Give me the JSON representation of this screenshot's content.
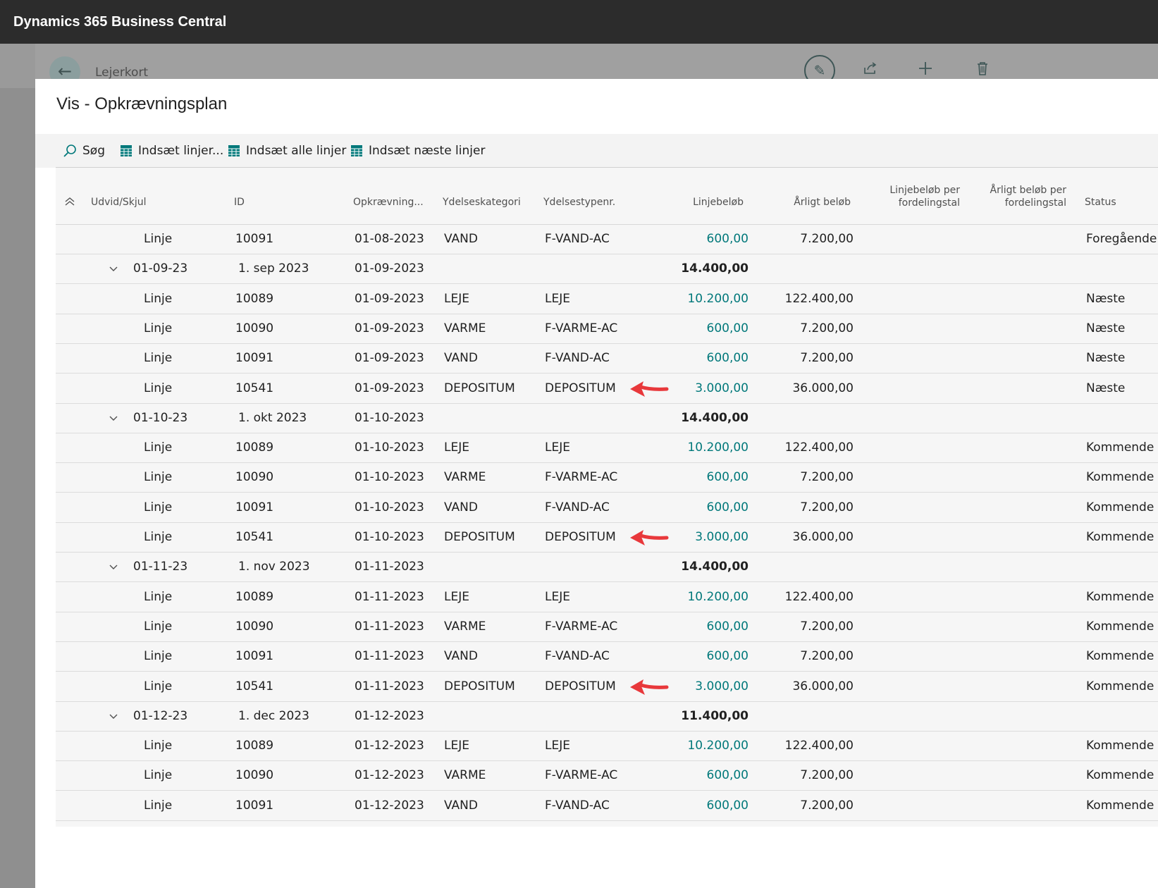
{
  "app": {
    "title": "Dynamics 365 Business Central"
  },
  "background_page": {
    "title": "Lejerkort"
  },
  "dialog": {
    "title": "Vis - Opkrævningsplan"
  },
  "actions": {
    "search": "Søg",
    "insert_lines": "Indsæt linjer...",
    "insert_all_lines": "Indsæt alle linjer",
    "insert_next_lines": "Indsæt næste linjer"
  },
  "columns": {
    "expand": "Udvid/Skjul",
    "id": "ID",
    "billing": "Opkrævning...",
    "category": "Ydelseskategori",
    "type": "Ydelsestypenr.",
    "line_amount": "Linjebeløb",
    "annual_amount": "Årligt beløb",
    "line_per_1": "Linjebeløb per",
    "line_per_2": "fordelingstal",
    "annual_per_1": "Årligt beløb per",
    "annual_per_2": "fordelingstal",
    "status": "Status"
  },
  "rows": [
    {
      "kind": "line",
      "label": "Linje",
      "id": "10091",
      "date": "01-08-2023",
      "category": "VAND",
      "type": "F-VAND-AC",
      "amount": "600,00",
      "annual": "7.200,00",
      "status": "Foregående"
    },
    {
      "kind": "group",
      "label": "01-09-23",
      "id": "1. sep 2023",
      "date": "01-09-2023",
      "amount": "14.400,00"
    },
    {
      "kind": "line",
      "label": "Linje",
      "id": "10089",
      "date": "01-09-2023",
      "category": "LEJE",
      "type": "LEJE",
      "amount": "10.200,00",
      "annual": "122.400,00",
      "status": "Næste"
    },
    {
      "kind": "line",
      "label": "Linje",
      "id": "10090",
      "date": "01-09-2023",
      "category": "VARME",
      "type": "F-VARME-AC",
      "amount": "600,00",
      "annual": "7.200,00",
      "status": "Næste"
    },
    {
      "kind": "line",
      "label": "Linje",
      "id": "10091",
      "date": "01-09-2023",
      "category": "VAND",
      "type": "F-VAND-AC",
      "amount": "600,00",
      "annual": "7.200,00",
      "status": "Næste"
    },
    {
      "kind": "line",
      "label": "Linje",
      "id": "10541",
      "date": "01-09-2023",
      "category": "DEPOSITUM",
      "type": "DEPOSITUM",
      "amount": "3.000,00",
      "annual": "36.000,00",
      "status": "Næste",
      "arrow": true
    },
    {
      "kind": "group",
      "label": "01-10-23",
      "id": "1. okt 2023",
      "date": "01-10-2023",
      "amount": "14.400,00"
    },
    {
      "kind": "line",
      "label": "Linje",
      "id": "10089",
      "date": "01-10-2023",
      "category": "LEJE",
      "type": "LEJE",
      "amount": "10.200,00",
      "annual": "122.400,00",
      "status": "Kommende"
    },
    {
      "kind": "line",
      "label": "Linje",
      "id": "10090",
      "date": "01-10-2023",
      "category": "VARME",
      "type": "F-VARME-AC",
      "amount": "600,00",
      "annual": "7.200,00",
      "status": "Kommende"
    },
    {
      "kind": "line",
      "label": "Linje",
      "id": "10091",
      "date": "01-10-2023",
      "category": "VAND",
      "type": "F-VAND-AC",
      "amount": "600,00",
      "annual": "7.200,00",
      "status": "Kommende"
    },
    {
      "kind": "line",
      "label": "Linje",
      "id": "10541",
      "date": "01-10-2023",
      "category": "DEPOSITUM",
      "type": "DEPOSITUM",
      "amount": "3.000,00",
      "annual": "36.000,00",
      "status": "Kommende",
      "arrow": true
    },
    {
      "kind": "group",
      "label": "01-11-23",
      "id": "1. nov 2023",
      "date": "01-11-2023",
      "amount": "14.400,00"
    },
    {
      "kind": "line",
      "label": "Linje",
      "id": "10089",
      "date": "01-11-2023",
      "category": "LEJE",
      "type": "LEJE",
      "amount": "10.200,00",
      "annual": "122.400,00",
      "status": "Kommende"
    },
    {
      "kind": "line",
      "label": "Linje",
      "id": "10090",
      "date": "01-11-2023",
      "category": "VARME",
      "type": "F-VARME-AC",
      "amount": "600,00",
      "annual": "7.200,00",
      "status": "Kommende"
    },
    {
      "kind": "line",
      "label": "Linje",
      "id": "10091",
      "date": "01-11-2023",
      "category": "VAND",
      "type": "F-VAND-AC",
      "amount": "600,00",
      "annual": "7.200,00",
      "status": "Kommende"
    },
    {
      "kind": "line",
      "label": "Linje",
      "id": "10541",
      "date": "01-11-2023",
      "category": "DEPOSITUM",
      "type": "DEPOSITUM",
      "amount": "3.000,00",
      "annual": "36.000,00",
      "status": "Kommende",
      "arrow": true
    },
    {
      "kind": "group",
      "label": "01-12-23",
      "id": "1. dec 2023",
      "date": "01-12-2023",
      "amount": "11.400,00"
    },
    {
      "kind": "line",
      "label": "Linje",
      "id": "10089",
      "date": "01-12-2023",
      "category": "LEJE",
      "type": "LEJE",
      "amount": "10.200,00",
      "annual": "122.400,00",
      "status": "Kommende"
    },
    {
      "kind": "line",
      "label": "Linje",
      "id": "10090",
      "date": "01-12-2023",
      "category": "VARME",
      "type": "F-VARME-AC",
      "amount": "600,00",
      "annual": "7.200,00",
      "status": "Kommende"
    },
    {
      "kind": "line",
      "label": "Linje",
      "id": "10091",
      "date": "01-12-2023",
      "category": "VAND",
      "type": "F-VAND-AC",
      "amount": "600,00",
      "annual": "7.200,00",
      "status": "Kommende"
    }
  ],
  "colors": {
    "accent": "#00787a",
    "arrow": "#e8383b",
    "topbar": "#2c2c2c"
  }
}
